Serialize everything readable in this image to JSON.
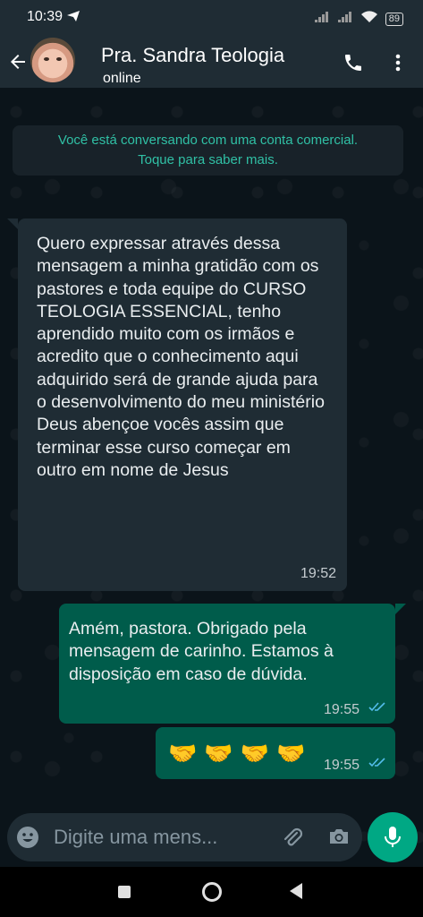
{
  "status_bar": {
    "time": "10:39",
    "battery": "89"
  },
  "header": {
    "contact_name": "Pra. Sandra Teologia",
    "status": "online"
  },
  "business_notice": {
    "line1": "Você está conversando com uma conta comercial.",
    "line2": "Toque para saber mais."
  },
  "messages": [
    {
      "direction": "incoming",
      "text": "Quero expressar através dessa mensagem a minha gratidão com os pastores e toda equipe do CURSO TEOLOGIA ESSENCIAL, tenho aprendido muito com os irmãos e acredito que o conhecimento aqui adquirido será de grande ajuda para o desenvolvimento do meu ministério Deus abençoe vocês assim que terminar esse curso começar em outro em nome de Jesus",
      "time": "19:52"
    },
    {
      "direction": "outgoing",
      "text": "Amém, pastora. Obrigado pela mensagem de carinho. Estamos à disposição em caso de dúvida.",
      "time": "19:55",
      "status": "read"
    },
    {
      "direction": "outgoing",
      "emojis": [
        "🤝",
        "🤝",
        "🤝",
        "🤝"
      ],
      "time": "19:55",
      "status": "read"
    }
  ],
  "composer": {
    "placeholder": "Digite uma mens..."
  },
  "colors": {
    "background": "#0b141a",
    "header": "#1f2c34",
    "incoming_bubble": "#1f2c34",
    "outgoing_bubble": "#005c4b",
    "accent": "#00a884",
    "read_ticks": "#53bdeb"
  },
  "icons": [
    "send-icon",
    "signal-icon",
    "wifi-icon",
    "battery-icon",
    "back-arrow-icon",
    "phone-icon",
    "more-vert-icon",
    "smiley-icon",
    "paperclip-icon",
    "camera-icon",
    "mic-icon",
    "read-ticks-icon",
    "nav-recents-icon",
    "nav-home-icon",
    "nav-back-icon"
  ]
}
